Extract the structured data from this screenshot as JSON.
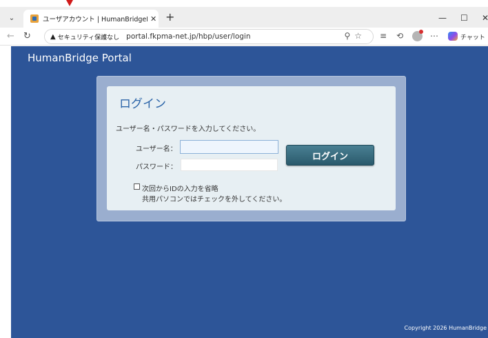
{
  "browser": {
    "tab_title": "ユーザアカウント | HumanBridgePorta",
    "tab_close": "✕",
    "new_tab": "+",
    "security_label": "セキュリティ保護なし",
    "url": "portal.fkpma-net.jp/hbp/user/login",
    "chat_label": "チャット",
    "minimize": "—",
    "maximize": "☐",
    "close": "✕"
  },
  "page": {
    "portal_title": "HumanBridge Portal",
    "login_heading": "ログイン",
    "instruction": "ユーザー名・パスワードを入力してください。",
    "username_label": "ユーザー名：",
    "password_label": "パスワード：",
    "username_value": "",
    "password_value": "",
    "login_button": "ログイン",
    "remember_label": "次回からIDの入力を省略",
    "remember_note": "共用パソコンではチェックを外してください。",
    "remember_checked": false,
    "copyright": "Copyright 2026 HumanBridge"
  },
  "colors": {
    "page_background": "#2d5598",
    "card_outer": "#9aaecf",
    "card_inner": "#e7eff3",
    "heading": "#2b64a8",
    "button": "#2a5a6c"
  }
}
